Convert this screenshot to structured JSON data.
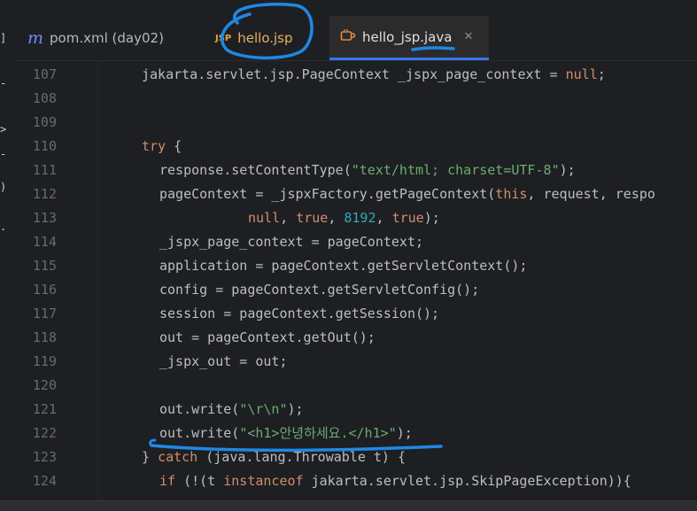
{
  "tabs": [
    {
      "label": "pom.xml (day02)",
      "icon": "maven-module-icon",
      "active": false
    },
    {
      "label": "hello.jsp",
      "icon": "jsp-file-icon",
      "active": false
    },
    {
      "label": "hello_jsp.java",
      "icon": "java-file-icon",
      "active": true
    }
  ],
  "colors": {
    "background": "#1e1f22",
    "keyword": "#cf8e6d",
    "string": "#6aab73",
    "number": "#2aacb8",
    "annotation": "#1e88e5",
    "active_tab_underline": "#3574f0"
  },
  "editor": {
    "lines": [
      {
        "num": "107",
        "indent": 4,
        "tokens": [
          {
            "t": "jakarta.servlet.jsp.PageContext _jspx_page_context = ",
            "c": ""
          },
          {
            "t": "null",
            "c": "kw"
          },
          {
            "t": ";",
            "c": ""
          }
        ]
      },
      {
        "num": "108",
        "indent": 0,
        "tokens": []
      },
      {
        "num": "109",
        "indent": 0,
        "tokens": []
      },
      {
        "num": "110",
        "indent": 4,
        "tokens": [
          {
            "t": "try",
            "c": "kw"
          },
          {
            "t": " {",
            "c": ""
          }
        ]
      },
      {
        "num": "111",
        "indent": 6,
        "tokens": [
          {
            "t": "response.setContentType(",
            "c": ""
          },
          {
            "t": "\"text/html; charset=UTF-8\"",
            "c": "str"
          },
          {
            "t": ");",
            "c": ""
          }
        ]
      },
      {
        "num": "112",
        "indent": 6,
        "tokens": [
          {
            "t": "pageContext = _jspxFactory.getPageContext(",
            "c": ""
          },
          {
            "t": "this",
            "c": "kw"
          },
          {
            "t": ", request, respo",
            "c": ""
          }
        ]
      },
      {
        "num": "113",
        "indent": 16,
        "tokens": [
          {
            "t": "null",
            "c": "kw"
          },
          {
            "t": ", ",
            "c": ""
          },
          {
            "t": "true",
            "c": "kw"
          },
          {
            "t": ", ",
            "c": ""
          },
          {
            "t": "8192",
            "c": "num"
          },
          {
            "t": ", ",
            "c": ""
          },
          {
            "t": "true",
            "c": "kw"
          },
          {
            "t": ");",
            "c": ""
          }
        ]
      },
      {
        "num": "114",
        "indent": 6,
        "tokens": [
          {
            "t": "_jspx_page_context = pageContext;",
            "c": ""
          }
        ]
      },
      {
        "num": "115",
        "indent": 6,
        "tokens": [
          {
            "t": "application = pageContext.getServletContext();",
            "c": ""
          }
        ]
      },
      {
        "num": "116",
        "indent": 6,
        "tokens": [
          {
            "t": "config = pageContext.getServletConfig();",
            "c": ""
          }
        ]
      },
      {
        "num": "117",
        "indent": 6,
        "tokens": [
          {
            "t": "session = pageContext.getSession();",
            "c": ""
          }
        ]
      },
      {
        "num": "118",
        "indent": 6,
        "tokens": [
          {
            "t": "out = pageContext.getOut();",
            "c": ""
          }
        ]
      },
      {
        "num": "119",
        "indent": 6,
        "tokens": [
          {
            "t": "_jspx_out = out;",
            "c": ""
          }
        ]
      },
      {
        "num": "120",
        "indent": 0,
        "tokens": []
      },
      {
        "num": "121",
        "indent": 6,
        "tokens": [
          {
            "t": "out.write(",
            "c": ""
          },
          {
            "t": "\"\\r\\n\"",
            "c": "str"
          },
          {
            "t": ");",
            "c": ""
          }
        ]
      },
      {
        "num": "122",
        "indent": 6,
        "tokens": [
          {
            "t": "out.write(",
            "c": ""
          },
          {
            "t": "\"<h1>안녕하세요.</h1>\"",
            "c": "str"
          },
          {
            "t": ");",
            "c": ""
          }
        ]
      },
      {
        "num": "123",
        "indent": 4,
        "tokens": [
          {
            "t": "} ",
            "c": ""
          },
          {
            "t": "catch",
            "c": "kw"
          },
          {
            "t": " (java.lang.Throwable t) {",
            "c": ""
          }
        ]
      },
      {
        "num": "124",
        "indent": 6,
        "tokens": [
          {
            "t": "if",
            "c": "kw"
          },
          {
            "t": " (!(t ",
            "c": ""
          },
          {
            "t": "instanceof",
            "c": "kw"
          },
          {
            "t": " jakarta.servlet.jsp.SkipPageException)){",
            "c": ""
          }
        ]
      }
    ]
  }
}
